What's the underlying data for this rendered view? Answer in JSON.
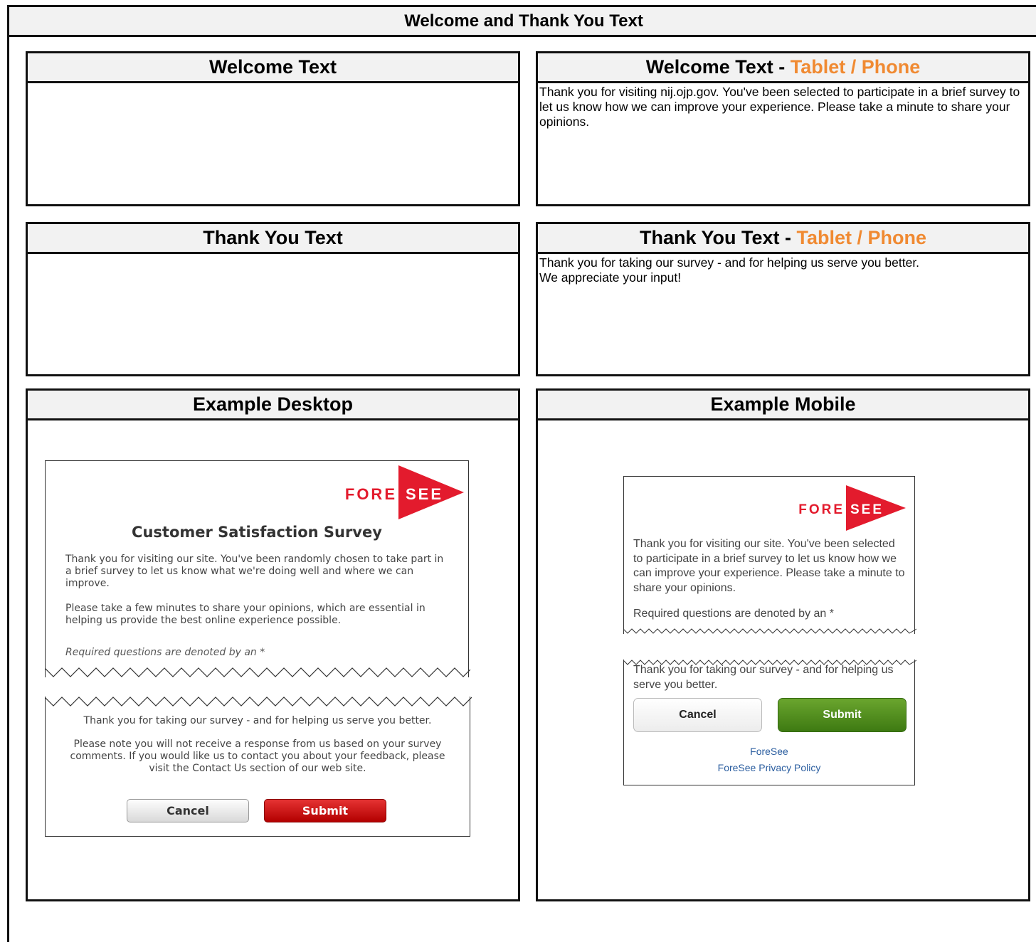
{
  "page": {
    "title": "Welcome and Thank You Text"
  },
  "panels": {
    "welcome": {
      "title": "Welcome Text",
      "body": ""
    },
    "welcome_tablet": {
      "title_prefix": "Welcome Text - ",
      "title_accent": "Tablet / Phone",
      "body": "Thank you for visiting nij.ojp.gov. You've been selected to participate in a brief survey to let us know how we can improve your experience. Please take a minute to share your opinions."
    },
    "thankyou": {
      "title": "Thank You Text",
      "body": ""
    },
    "thankyou_tablet": {
      "title_prefix": "Thank You Text - ",
      "title_accent": "Tablet / Phone",
      "body_line1": "Thank you for taking our survey - and for helping us serve you better.",
      "body_line2": "We appreciate your input!"
    },
    "example_desktop": {
      "title": "Example Desktop"
    },
    "example_mobile": {
      "title": "Example Mobile"
    }
  },
  "desktop_example": {
    "logo_fore": "FORE",
    "logo_see": "SEE",
    "survey_title": "Customer Satisfaction Survey",
    "intro_p1": "Thank you for visiting our site. You've been randomly chosen to take part in a brief survey to let us know what we're doing well and where we can improve.",
    "intro_p2": "Please take a few minutes to share your opinions, which are essential in helping us provide the best online experience possible.",
    "required_note": "Required questions are denoted by an *",
    "thanks": "Thank you for taking our survey - and for helping us serve you better.",
    "note": "Please note you will not receive a response from us based on your survey comments. If you would like us to contact you about your feedback, please visit the Contact Us section of our web site.",
    "cancel_label": "Cancel",
    "submit_label": "Submit"
  },
  "mobile_example": {
    "logo_fore": "FORE",
    "logo_see": "SEE",
    "intro": "Thank you for visiting our site. You've been selected to participate in a brief survey to let us know how we can improve your experience. Please take a minute to share your opinions.",
    "required_note": "Required questions are denoted by an *",
    "thanks": "Thank you for taking our survey - and for helping us serve you better.",
    "cancel_label": "Cancel",
    "submit_label": "Submit",
    "link1": "ForeSee",
    "link2": "ForeSee Privacy Policy"
  },
  "colors": {
    "accent_orange": "#f08a32",
    "foresee_red": "#e31b2d",
    "desktop_submit": "#c00000",
    "mobile_submit": "#4f8c1f",
    "link_blue": "#2a5d9f"
  }
}
